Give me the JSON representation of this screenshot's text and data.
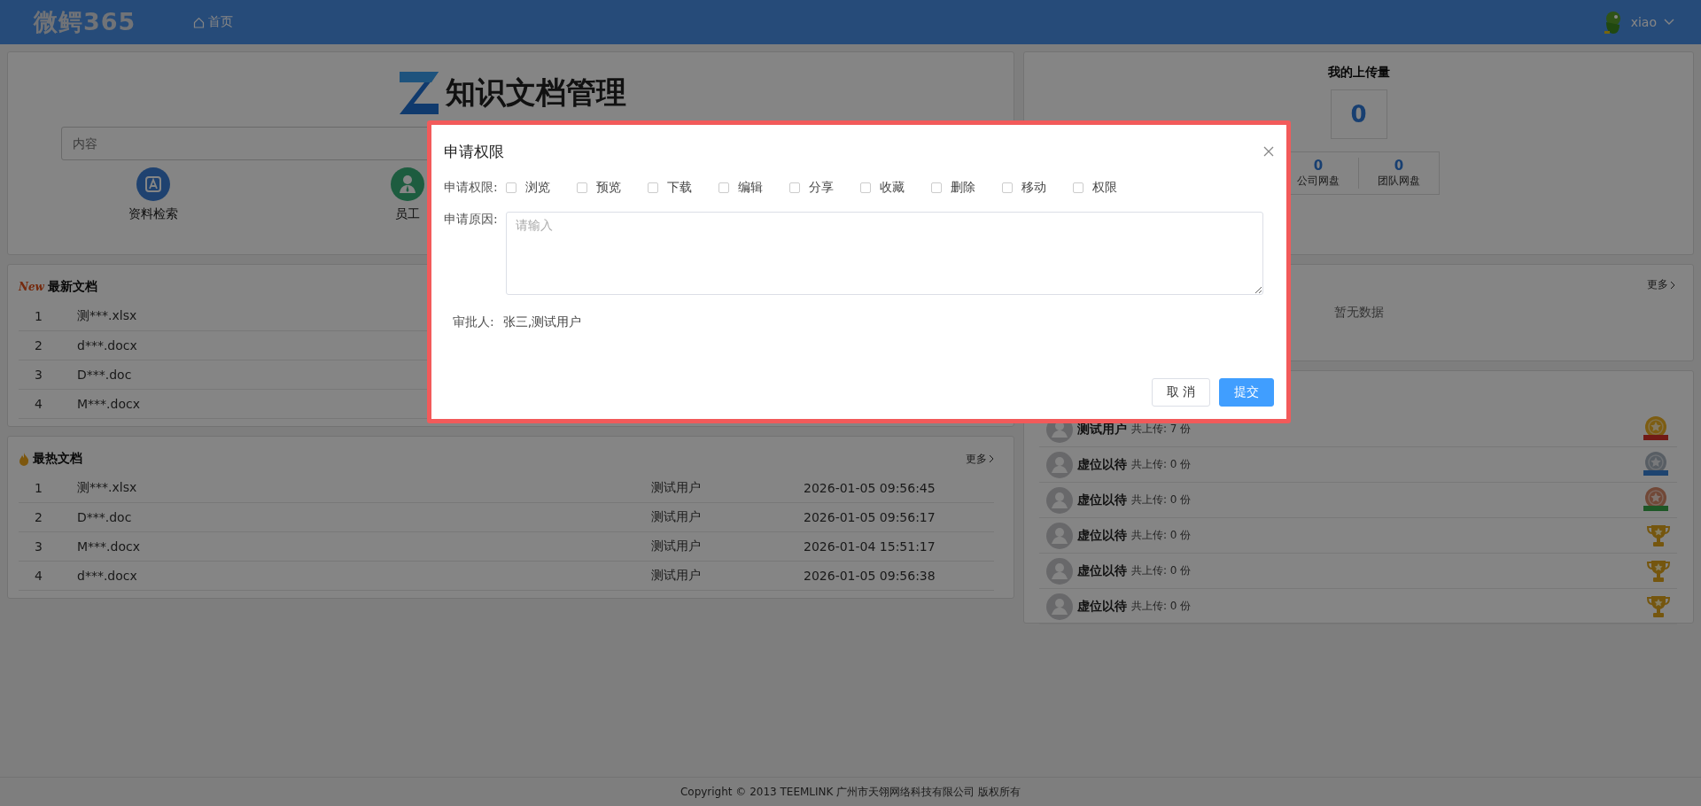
{
  "header": {
    "logo": "微鳄365",
    "nav": [
      {
        "label": "首页",
        "selected": true
      }
    ],
    "user": "xiao"
  },
  "search_card": {
    "title": "知识文档管理",
    "placeholder": "内容",
    "shortcuts": [
      {
        "label": "资料检索",
        "kind": "search"
      },
      {
        "label": "员工",
        "kind": "staff"
      }
    ]
  },
  "newest": {
    "title": "最新文档",
    "badge": "New",
    "rows": [
      {
        "index": "1",
        "name": "测***.xlsx"
      },
      {
        "index": "2",
        "name": "d***.docx"
      },
      {
        "index": "3",
        "name": "D***.doc"
      },
      {
        "index": "4",
        "name": "M***.docx"
      }
    ]
  },
  "hottest": {
    "title": "最热文档",
    "more": "更多",
    "rows": [
      {
        "index": "1",
        "name": "测***.xlsx",
        "user": "测试用户",
        "time": "2026-01-05 09:56:45"
      },
      {
        "index": "2",
        "name": "D***.doc",
        "user": "测试用户",
        "time": "2026-01-05 09:56:17"
      },
      {
        "index": "3",
        "name": "M***.docx",
        "user": "测试用户",
        "time": "2026-01-04 15:51:17"
      },
      {
        "index": "4",
        "name": "d***.docx",
        "user": "测试用户",
        "time": "2026-01-05 09:56:38"
      }
    ]
  },
  "uploads": {
    "title": "我的上传量",
    "total": "0",
    "stats": [
      {
        "value": "0",
        "label": "公司网盘"
      },
      {
        "value": "0",
        "label": "团队网盘"
      }
    ]
  },
  "middle_panel": {
    "more": "更多",
    "empty": "暂无数据"
  },
  "ranking": [
    {
      "name": "测试用户",
      "count": "共上传: 7 份",
      "kind": "gold"
    },
    {
      "name": "虚位以待",
      "count": "共上传: 0 份",
      "kind": "silver"
    },
    {
      "name": "虚位以待",
      "count": "共上传: 0 份",
      "kind": "bronze"
    },
    {
      "name": "虚位以待",
      "count": "共上传: 0 份",
      "kind": "trophy"
    },
    {
      "name": "虚位以待",
      "count": "共上传: 0 份",
      "kind": "trophy"
    },
    {
      "name": "虚位以待",
      "count": "共上传: 0 份",
      "kind": "trophy"
    }
  ],
  "footer": "Copyright © 2013 TEEMLINK 广州市天翎网络科技有限公司 版权所有",
  "dialog": {
    "title": "申请权限",
    "permissions_label": "申请权限:",
    "permissions": [
      {
        "label": "浏览",
        "checked": false
      },
      {
        "label": "预览",
        "checked": false
      },
      {
        "label": "下载",
        "checked": false
      },
      {
        "label": "编辑",
        "checked": false
      },
      {
        "label": "分享",
        "checked": false
      },
      {
        "label": "收藏",
        "checked": false
      },
      {
        "label": "删除",
        "checked": false
      },
      {
        "label": "移动",
        "checked": false
      },
      {
        "label": "权限",
        "checked": false
      }
    ],
    "reason_label": "申请原因:",
    "reason_placeholder": "请输入",
    "approver_label": "审批人:",
    "approver": "张三,测试用户",
    "buttons": [
      {
        "label": "取 消",
        "kind": "secondary"
      },
      {
        "label": "提交",
        "kind": "primary"
      }
    ]
  }
}
